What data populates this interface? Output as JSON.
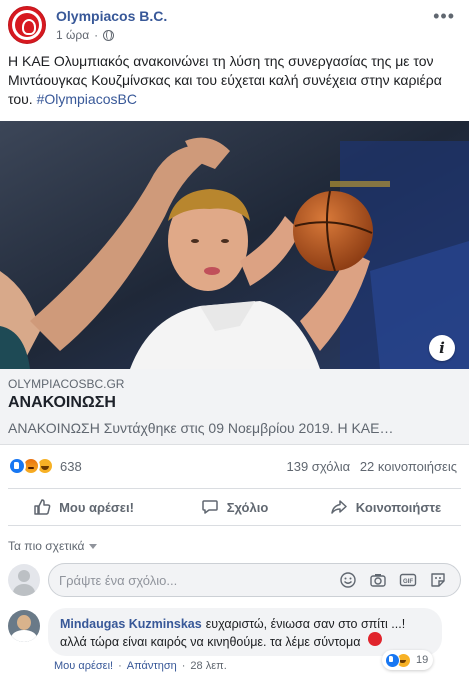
{
  "post": {
    "page_name": "Olympiacos B.C.",
    "time": "1 ώρα",
    "more_label": "•••",
    "text": "Η ΚΑΕ Ολυμπιακός ανακοινώνει τη λύση της συνεργασίας της με τον Μιντάουγκας Κουζμίνσκας και του εύχεται καλή συνέχεια στην καριέρα του.",
    "hashtag": "#OlympiacosBC"
  },
  "link_preview": {
    "domain": "OLYMPIACOSBC.GR",
    "title": "ΑΝΑΚΟΙΝΩΣΗ",
    "description": "ΑΝΑΚΟΙΝΩΣΗ Συντάχθηκε στις 09 Νοεμβρίου 2019. Η ΚΑΕ…",
    "info_label": "i"
  },
  "stats": {
    "reaction_count": "638",
    "comments": "139 σχόλια",
    "shares": "22 κοινοποιήσεις",
    "reactions": [
      "like-icon",
      "angry-icon",
      "haha-icon"
    ]
  },
  "actions": {
    "like": "Μου αρέσει!",
    "comment": "Σχόλιο",
    "share": "Κοινοποιήστε"
  },
  "comments_section": {
    "sort_label": "Τα πιο σχετικά",
    "composer_placeholder": "Γράψτε ένα σχόλιο...",
    "composer_icons": [
      "emoji-icon",
      "camera-icon",
      "gif-icon",
      "sticker-icon"
    ]
  },
  "top_comment": {
    "author": "Mindaugas Kuzminskas",
    "text_line1": "ευχαριστώ, ένιωσα σαν στο σπίτι ...!",
    "text_line2": "αλλά τώρα είναι καιρός να κινηθούμε. τα λέμε σύντομα",
    "reaction_count": "19",
    "like_label": "Μου αρέσει!",
    "reply_label": "Απάντηση",
    "separator": "·",
    "time": "28 λεπ."
  },
  "colors": {
    "brand_red": "#d71920",
    "link_blue": "#385898",
    "fb_blue": "#1877f2"
  }
}
